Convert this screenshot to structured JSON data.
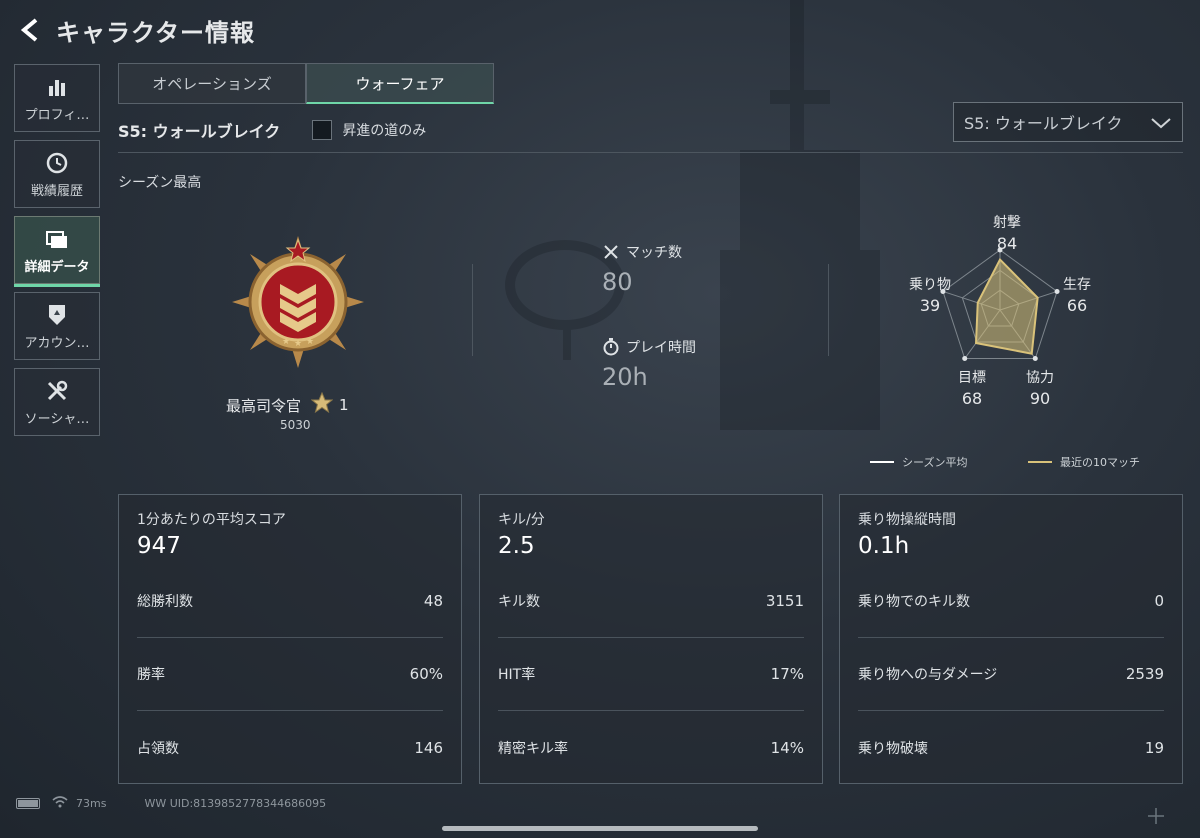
{
  "header": {
    "title": "キャラクター情報"
  },
  "sidebar": {
    "items": [
      {
        "label": "プロフィ…",
        "icon": "bar-chart-icon"
      },
      {
        "label": "戦績履歴",
        "icon": "history-clock-icon"
      },
      {
        "label": "詳細データ",
        "icon": "folder-icon",
        "active": true
      },
      {
        "label": "アカウン…",
        "icon": "badge-icon"
      },
      {
        "label": "ソーシャ…",
        "icon": "tools-icon"
      }
    ]
  },
  "tabs": [
    {
      "label": "オペレーションズ",
      "active": false
    },
    {
      "label": "ウォーフェア",
      "active": true
    }
  ],
  "season": {
    "label": "S5: ウォールブレイク",
    "checkbox_label": "昇進の道のみ",
    "checkbox_checked": false,
    "select_value": "S5: ウォールブレイク"
  },
  "season_best": {
    "section_title": "シーズン最高",
    "rank_name": "最高司令官",
    "rank_stars": "1",
    "rank_points": "5030"
  },
  "summary": {
    "matches_label": "マッチ数",
    "matches_value": "80",
    "playtime_label": "プレイ時間",
    "playtime_value": "20h"
  },
  "radar": {
    "axes": [
      {
        "name": "射撃",
        "value": 84
      },
      {
        "name": "生存",
        "value": 66
      },
      {
        "name": "協力",
        "value": 90
      },
      {
        "name": "目標",
        "value": 68
      },
      {
        "name": "乗り物",
        "value": 39
      }
    ],
    "legend": {
      "season_avg": "シーズン平均",
      "recent": "最近の10マッチ"
    },
    "colors": {
      "recent": "#d9c27a",
      "season_avg": "#ffffff"
    }
  },
  "cards": [
    {
      "label": "1分あたりの平均スコア",
      "big": "947",
      "rows": [
        {
          "label": "総勝利数",
          "value": "48"
        },
        {
          "label": "勝率",
          "value": "60%"
        },
        {
          "label": "占領数",
          "value": "146"
        }
      ]
    },
    {
      "label": "キル/分",
      "big": "2.5",
      "rows": [
        {
          "label": "キル数",
          "value": "3151"
        },
        {
          "label": "HIT率",
          "value": "17%"
        },
        {
          "label": "精密キル率",
          "value": "14%"
        }
      ]
    },
    {
      "label": "乗り物操縦時間",
      "big": "0.1h",
      "rows": [
        {
          "label": "乗り物でのキル数",
          "value": "0"
        },
        {
          "label": "乗り物への与ダメージ",
          "value": "2539"
        },
        {
          "label": "乗り物破壊",
          "value": "19"
        }
      ]
    }
  ],
  "footer": {
    "ping": "73ms",
    "uid": "WW UID:8139852778344686095"
  },
  "accent_color": "#6fd6a8"
}
